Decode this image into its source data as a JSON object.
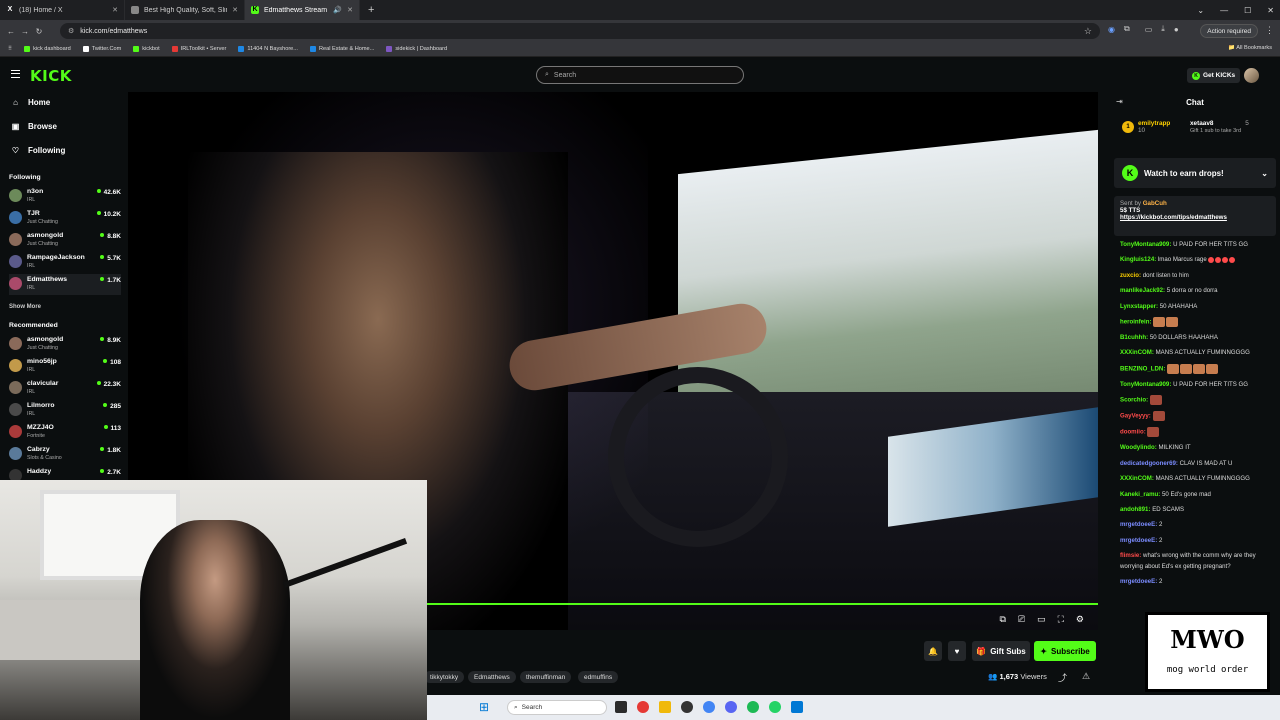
{
  "browser": {
    "tabs": [
      {
        "icon": "x-icon",
        "title": "(18) Home / X"
      },
      {
        "icon": "shop-icon",
        "title": "Best High Quality, Soft, Slim Fit..."
      },
      {
        "icon": "kick-icon",
        "title": "Edmatthews Stream - Watc..."
      }
    ],
    "url": "kick.com/edmatthews",
    "action_required": "Action required",
    "bookmarks": [
      {
        "label": "kick dashboard",
        "color": "#53fc18"
      },
      {
        "label": "Twitter.Com",
        "color": "#ffffff"
      },
      {
        "label": "kickbot",
        "color": "#53fc18"
      },
      {
        "label": "IRLToolkit • Server",
        "color": "#e53935"
      },
      {
        "label": "11404 N Bayshore...",
        "color": "#1e88e5"
      },
      {
        "label": "Real Estate & Home...",
        "color": "#1e88e5"
      },
      {
        "label": "sidekick | Dashboard",
        "color": "#7e57c2"
      }
    ],
    "all_bookmarks": "All Bookmarks"
  },
  "header": {
    "logo": "KICK",
    "search_placeholder": "Search",
    "get_kicks": "Get KICKs"
  },
  "sidebar": {
    "nav": [
      {
        "label": "Home",
        "icon": "home-icon"
      },
      {
        "label": "Browse",
        "icon": "browse-icon"
      },
      {
        "label": "Following",
        "icon": "heart-icon"
      }
    ],
    "following_title": "Following",
    "following": [
      {
        "name": "n3on",
        "category": "IRL",
        "viewers": "42.6K",
        "color": "#6c8a5a"
      },
      {
        "name": "TJR",
        "category": "Just Chatting",
        "viewers": "10.2K",
        "color": "#3a6ea5"
      },
      {
        "name": "asmongold",
        "category": "Just Chatting",
        "viewers": "8.8K",
        "color": "#8a6a5a"
      },
      {
        "name": "RampageJackson",
        "category": "IRL",
        "viewers": "5.7K",
        "color": "#5a5a8a"
      },
      {
        "name": "Edmatthews",
        "category": "IRL",
        "viewers": "1.7K",
        "color": "#aa4a6a"
      }
    ],
    "show_more": "Show More",
    "recommended_title": "Recommended",
    "recommended": [
      {
        "name": "asmongold",
        "category": "Just Chatting",
        "viewers": "8.9K",
        "color": "#8a6a5a"
      },
      {
        "name": "mino56jp",
        "category": "IRL",
        "viewers": "108",
        "color": "#c29a4a"
      },
      {
        "name": "clavicular",
        "category": "IRL",
        "viewers": "22.3K",
        "color": "#7a6a5a"
      },
      {
        "name": "Lilmorro",
        "category": "IRL",
        "viewers": "285",
        "color": "#4a4a4a"
      },
      {
        "name": "MZZJ4O",
        "category": "Fortnite",
        "viewers": "113",
        "color": "#aa3a3a"
      },
      {
        "name": "Cabrzy",
        "category": "Slots & Casino",
        "viewers": "1.8K",
        "color": "#5a7a9a"
      },
      {
        "name": "Haddzy",
        "category": "",
        "viewers": "2.7K",
        "color": "#333"
      }
    ]
  },
  "stream": {
    "tags": [
      "tikkytokky",
      "Edmatthews",
      "themuffinman",
      "edmuffins"
    ],
    "viewers": "1,673",
    "viewers_label": "Viewers",
    "gift_subs": "Gift Subs",
    "subscribe": "Subscribe"
  },
  "chat": {
    "title": "Chat",
    "pinned_user": "emilytrapp",
    "pinned_amount": "10",
    "pinned_user2": "xetaav8",
    "pinned_amount2": "5",
    "pinned_note": "Gift 1 sub to take 3rd",
    "drops": "Watch to earn drops!",
    "tts_sent_by": "Sent by",
    "tts_user": "GabCuh",
    "tts_amount": "5$ TTS",
    "tts_link": "https://kickbot.com/tips/edmatthews",
    "messages": [
      {
        "user": "TonyMontana909:",
        "color": "#53fc18",
        "text": "U PAID FOR HER TITS GG"
      },
      {
        "user": "Kingluis124:",
        "color": "#53fc18",
        "text": "lmao Marcus rage"
      },
      {
        "user": "zuxcio:",
        "color": "#ffd000",
        "text": "dont listen to him"
      },
      {
        "user": "manlikeJack92:",
        "color": "#53fc18",
        "text": "5 dorra or no dorra"
      },
      {
        "user": "Lynxstapper:",
        "color": "#53fc18",
        "text": "50 AHAHAHA"
      },
      {
        "user": "heroinfein:",
        "color": "#53fc18",
        "text": ""
      },
      {
        "user": "B1cuhhh:",
        "color": "#53fc18",
        "text": "50 DOLLARS HAAHAHA"
      },
      {
        "user": "XXXinCOM:",
        "color": "#53fc18",
        "text": "MANS ACTUALLY FUMINNGGGG"
      },
      {
        "user": "BENZINO_LDN:",
        "color": "#53fc18",
        "text": ""
      },
      {
        "user": "TonyMontana909:",
        "color": "#53fc18",
        "text": "U PAID FOR HER TITS GG"
      },
      {
        "user": "Scorchio:",
        "color": "#53fc18",
        "text": ""
      },
      {
        "user": "GayVeyyy:",
        "color": "#ff4b4b",
        "text": ""
      },
      {
        "user": "doomiio:",
        "color": "#ff4b4b",
        "text": ""
      },
      {
        "user": "Woodylindo:",
        "color": "#53fc18",
        "text": "MILKING IT"
      },
      {
        "user": "dedicatedgooner69:",
        "color": "#7b8cff",
        "text": "CLAV IS MAD AT U"
      },
      {
        "user": "XXXinCOM:",
        "color": "#53fc18",
        "text": "MANS ACTUALLY FUMINNGGGG"
      },
      {
        "user": "Kaneki_ramu:",
        "color": "#53fc18",
        "text": "50 Ed's gone mad"
      },
      {
        "user": "andoh891:",
        "color": "#53fc18",
        "text": "ED SCAMS"
      },
      {
        "user": "mrgetdoeeE:",
        "color": "#7b8cff",
        "text": "2"
      },
      {
        "user": "mrgetdoeeE:",
        "color": "#7b8cff",
        "text": "2"
      },
      {
        "user": "flimsie:",
        "color": "#ff4b4b",
        "text": "what's wrong with the comm why are they worrying about Ed's ex getting pregnant?"
      },
      {
        "user": "mrgetdoeeE:",
        "color": "#7b8cff",
        "text": "2"
      }
    ],
    "overlay_text": "mog world order"
  },
  "taskbar": {
    "search_placeholder": "Search"
  }
}
